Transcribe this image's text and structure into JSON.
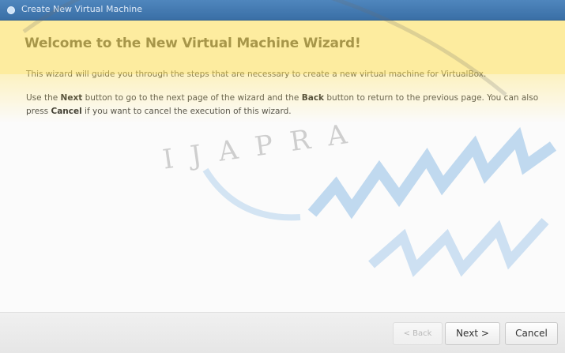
{
  "window": {
    "title": "Create New Virtual Machine",
    "title_icon": "virtualbox-icon"
  },
  "content": {
    "heading": "Welcome to the New Virtual Machine Wizard!",
    "paragraph1": "This wizard will guide you through the steps that are necessary to create a new virtual machine for VirtualBox.",
    "paragraph2": {
      "part1": "Use the ",
      "next_word": "Next",
      "part2": " button to go to the next page of the wizard and the ",
      "back_word": "Back",
      "part3": " button to return to the previous page. You can also press ",
      "cancel_word": "Cancel",
      "part4": " if you want to cancel the execution of this wizard."
    }
  },
  "buttons": {
    "back_label": "< Back",
    "next_label": "Next >",
    "cancel_label": "Cancel",
    "back_enabled": false
  },
  "watermark": {
    "letters": "IJAPRA"
  },
  "colors": {
    "titlebar": "#3a6fa6",
    "watermark_yellow": "#ffe054"
  }
}
